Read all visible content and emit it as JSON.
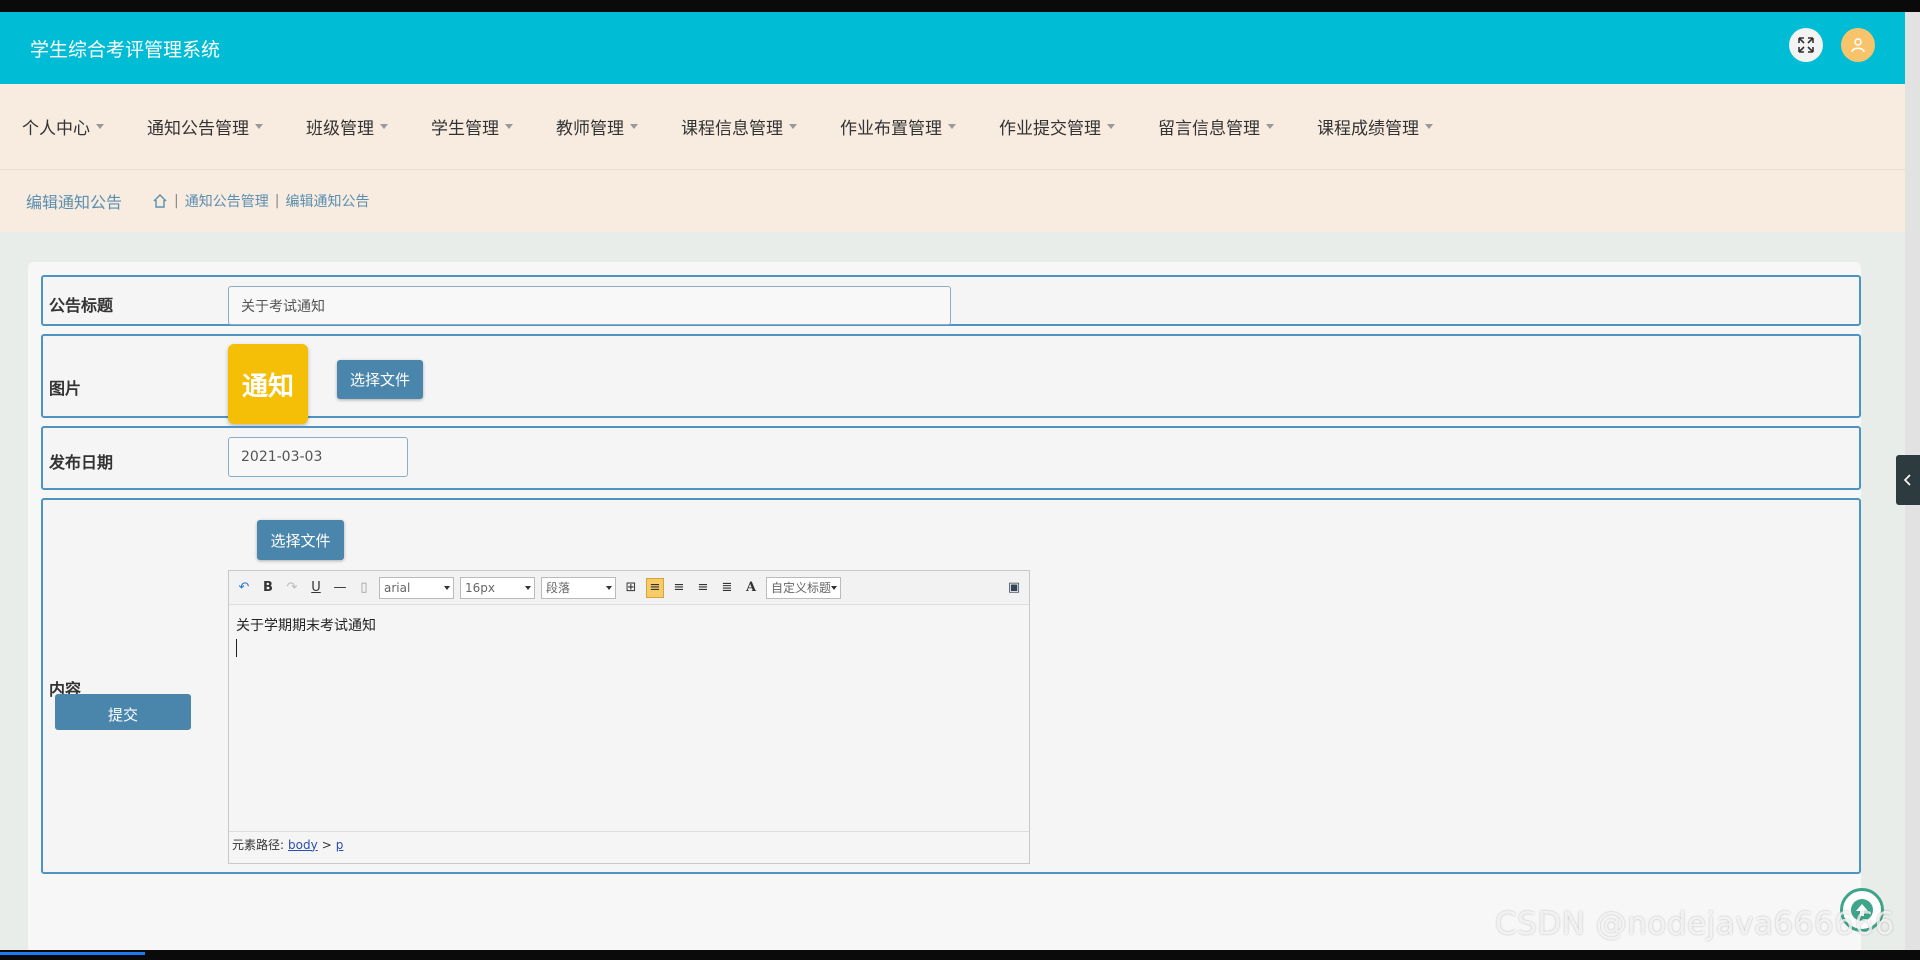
{
  "header": {
    "app_title": "学生综合考评管理系统"
  },
  "nav": {
    "items": [
      "个人中心",
      "通知公告管理",
      "班级管理",
      "学生管理",
      "教师管理",
      "课程信息管理",
      "作业布置管理",
      "作业提交管理",
      "留言信息管理",
      "课程成绩管理"
    ]
  },
  "breadcrumb": {
    "page_title": "编辑通知公告",
    "path": [
      "通知公告管理",
      "编辑通知公告"
    ]
  },
  "form": {
    "title_label": "公告标题",
    "title_value": "关于考试通知",
    "image_label": "图片",
    "image_thumb_text": "通知",
    "choose_file_label": "选择文件",
    "date_label": "发布日期",
    "date_value": "2021-03-03",
    "content_label": "内容",
    "submit_label": "提交"
  },
  "editor": {
    "font_family": "arial",
    "font_size": "16px",
    "paragraph": "段落",
    "custom_heading": "自定义标题",
    "content_text": "关于学期期末考试通知",
    "status_prefix": "元素路径:",
    "status_path": [
      "body",
      "p"
    ],
    "status_sep": ">"
  },
  "watermark": "CSDN @nodejava666666",
  "colors": {
    "header": "#00bcd4",
    "nav_bg": "#f8ebe0",
    "button": "#4a86ab",
    "border": "#4e94c2",
    "thumb": "#f4bf06"
  }
}
